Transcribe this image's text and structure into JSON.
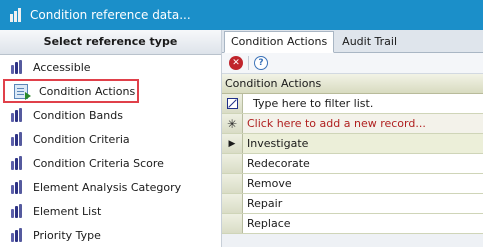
{
  "window": {
    "title": "Condition reference data..."
  },
  "left_panel": {
    "header": "Select reference type",
    "items": [
      {
        "label": "Accessible",
        "icon": "reference-bars-icon"
      },
      {
        "label": "Condition Actions",
        "icon": "condition-actions-icon",
        "selected": true
      },
      {
        "label": "Condition Bands",
        "icon": "reference-bars-icon"
      },
      {
        "label": "Condition Criteria",
        "icon": "reference-bars-icon"
      },
      {
        "label": "Condition Criteria Score",
        "icon": "reference-bars-icon"
      },
      {
        "label": "Element Analysis Category",
        "icon": "reference-bars-icon"
      },
      {
        "label": "Element List",
        "icon": "reference-bars-icon"
      },
      {
        "label": "Priority Type",
        "icon": "reference-bars-icon"
      }
    ]
  },
  "tabs": [
    {
      "label": "Condition Actions",
      "active": true
    },
    {
      "label": "Audit Trail",
      "active": false
    }
  ],
  "toolbar": {
    "delete_icon": "delete-icon",
    "help_icon": "help-icon"
  },
  "grid": {
    "caption": "Condition Actions",
    "filter_placeholder": "Type here to filter list.",
    "add_record": "Click here to add a new record...",
    "rows": [
      "Investigate",
      "Redecorate",
      "Remove",
      "Repair",
      "Replace"
    ],
    "current_row": 0
  },
  "colors": {
    "titlebar": "#1b8fc9",
    "selection_outline": "#e0404a",
    "add_record_text": "#b02020"
  }
}
